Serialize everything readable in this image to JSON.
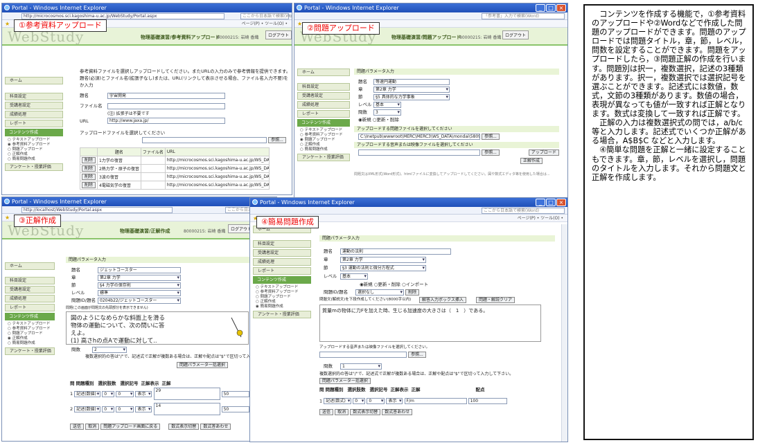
{
  "w1": {
    "title": "Portal - Windows Internet Explorer",
    "addr": "http://microcosmos.sci.kagoshima-u.ac.jp/WebStudy/Portal.aspx",
    "search": "ここから日本語で検索(Word)",
    "cmd": "ページ(P) • ツール(O) •",
    "logo": "WebStudy",
    "page_title": "物理基礎演習/参考資料アップロード",
    "user": "80000215: 岩崎 香織",
    "logout": "ログアウト",
    "label": "①参考資料アップロード",
    "intro": "参考資料ファイルを選択しアップロードしてください。またURLの入力のみで参考情報を提供できます。",
    "intro2": "題名(必須)とファイル名(拡張子なし)または、URL(リンクして表示させる場合、ファイル名入力不要)を入力し",
    "intro3": "か入力",
    "lbl_title": "題名",
    "val_title": "宇宙開発",
    "lbl_file": "ファイル名",
    "note_file": "(注) 拡張子は不要です",
    "lbl_url": "URL",
    "val_url": "http://www.jaxa.jp/",
    "select_file": "アップロードファイルを選択してください",
    "browse": "参照...",
    "col1": "題名",
    "col2": "ファイル名",
    "col3": "URL",
    "del": "削除",
    "rows": [
      {
        "t": "1力学の復習",
        "u": "http://microcosmos.sci.kagoshima-u.ac.jp/WS_DATA/basicphysics/dynamics/index.html"
      },
      {
        "t": "2熱力学・原子の復習",
        "u": "http://microcosmos.sci.kagoshima-u.ac.jp/WS_DATA/basicphysics/thermodynamics/index.html"
      },
      {
        "t": "3波の復習",
        "u": "http://microcosmos.sci.kagoshima-u.ac.jp/WS_DATA/basicphysics/wave/index.html"
      },
      {
        "t": "4電磁気学の復習",
        "u": "http://microcosmos.sci.kagoshima-u.ac.jp/WS_DATA/basicphysics/electromagnetism/index.html"
      }
    ]
  },
  "side": {
    "home": "ホーム",
    "items": [
      "科目設定",
      "受講者設定",
      "成績処理",
      "レポート"
    ],
    "section": "コンテンツ作成",
    "subs": [
      "テキストアップロード",
      "参考資料アップロード",
      "問題アップロード",
      "正解作成",
      "簡易問題作成"
    ],
    "survey": "アンケート・授業評価"
  },
  "w2": {
    "title": "Portal - Windows Internet Explorer",
    "search": "「参考書」入力で検索(Word)",
    "page_title": "物理基礎演習/問題アップロード",
    "user": "80000215: 岩崎 香織",
    "logout": "ログアウト",
    "label": "②問題アップロード",
    "param": "問題パラメータ入力",
    "lbl_name": "題名",
    "val_name": "等速円運動",
    "lbl_ch": "章",
    "val_ch": "第2章 力学",
    "lbl_sec": "節",
    "val_sec": "§5 具体的な力学事象",
    "lbl_lv": "レベル",
    "val_lv": "基本",
    "lbl_n": "問数",
    "val_n": "3",
    "mode": "◉新規 ○更新・削除",
    "word_sel": "アップロードする問題ファイルを選択してください",
    "word_path": "C:\\Inetpub\\wwwroot\\MERC\\MERC3\\WS_DATA\\mondai\\580911661101",
    "browse": "参照...",
    "media_sel": "アップロードする音声または映像ファイルを選択してください",
    "upload": "アップロード",
    "reg": "正解作成",
    "note": "問題文はXML形式(Word形式)、htmlファイルに変換してアップロードしてください。図や数式エディタ等を使用した場合は..."
  },
  "w3": {
    "title": "Portal - Windows Internet Explorer",
    "addr": "http://localhost/WebStudy/Portal.aspx",
    "search": "ここから日本語で検索(Word)",
    "page_title": "物理基礎演習/正解作成",
    "user": "80000215: 岩崎 香織",
    "logout": "ログアウト",
    "label": "③正解作成",
    "param": "問題パラメータ入力",
    "lbl_name": "題名",
    "val_name": "ジェットコースター",
    "lbl_ch": "章",
    "val_ch": "第2章 力学",
    "lbl_sec": "節",
    "val_sec": "§4 力学の保存則",
    "lbl_lv": "レベル",
    "val_lv": "標準",
    "lbl_id": "問題ID/題名",
    "val_id": "0204b22/ジェットコースター",
    "preview_hdr": "問題(この画面が問題文の先頭部分を表示できません)",
    "q1": "図のようになめらかな斜面上を滑る",
    "q2": "物体の運動について、次の問いに答",
    "q3": "えよ。",
    "q4": "(1) 高さhの点Aで運動に対して..",
    "lbl_count": "問数",
    "val_count": "2",
    "hint": "複数選択的の答は\"/\"で、記述式で正解が複数ある場合は、正解や配点は\"$\"で区切って入",
    "reset": "問題パラメータ一括選択",
    "cols": [
      "問",
      "問題種別",
      "選択肢数",
      "選択記号",
      "正解表示",
      "正解",
      "配点"
    ],
    "r1": {
      "n": "1",
      "type": "記述(数値)",
      "c": "0",
      "s": "0",
      "disp": "表示",
      "ans": "29",
      "pt": "50"
    },
    "r2": {
      "n": "2",
      "type": "記述(数値)",
      "c": "0",
      "s": "0",
      "disp": "表示",
      "ans": "14",
      "pt": "50"
    },
    "b_send": "送信",
    "b_cancel": "取消",
    "b_back": "問題アップロード画面に戻る",
    "b_fmt": "数式表示切替",
    "b_fmt2": "数式答あわせ"
  },
  "w4": {
    "title": "Portal - Windows Internet Explorer",
    "search": "ここから日本語で検索(Word)",
    "label": "④簡易問題作成",
    "param": "問題パラメータ入力",
    "lbl_name": "題名",
    "val_name": "運動の法則",
    "lbl_ch": "章",
    "val_ch": "第2章 力学",
    "lbl_sec": "節",
    "val_sec": "§3 運動の法則と微分方程式",
    "lbl_lv": "レベル",
    "val_lv": "基本",
    "mode": "◉新規 ○更新・削除 ○インポート",
    "lbl_id": "問題ID/題名",
    "val_id": "選択なし",
    "del": "削除",
    "text_hdr": "問題文(解説文)を下段作成してください(8000字以内)",
    "b_insert": "解答入力ボックス挿入",
    "b_clear": "問題・解説クリア",
    "qtext": "質量mの物体に力Fを加えた時、生じる加速度の大きさは（　1　）である。",
    "media": "アップロードする音声または映像ファイルを選択してください。",
    "browse": "参照...",
    "lbl_count": "問数",
    "val_count": "1",
    "hint": "複数選択的の答は\"/\"で、記述式で正解が複数ある場合は、正解や配点は\"$\"で区切って入力して下さい。",
    "reset": "問題パラメーター括選択",
    "cols": [
      "問",
      "問題種別",
      "選択肢数",
      "選択記号",
      "正解表示",
      "正解",
      "配点"
    ],
    "r1": {
      "n": "1",
      "type": "記述(数式)",
      "c": "0",
      "s": "0",
      "disp": "表示",
      "ans": "F/m",
      "pt": "100"
    },
    "b_send": "送信",
    "b_cancel": "取消",
    "b_fmt": "数式表示切替",
    "b_fmt2": "数式答あわせ"
  },
  "desc": {
    "p1": "　コンテンツを作成する機能で，①参考資料のアップロードや②Wordなどで作成した問題のアップロードができます。問題のアップロードでは問題タイトル，章，節，レベル，問数を設定することができます。問題をアップロードしたら，③問題正解の作成を行います。問題別は択一，複数選択，記述の3種類があります。択一，複数選択では選択記号を選ぶことができます。記述式には数値，数式，文節の3種類があります。数値の場合，表現が異なっても値が一致すれば正解となります。数式は変換して一致すれば正解です。",
    "p2": "　正解の入力は複数選択式の問では，a/b/c 等と入力します。記述式でいくつか正解がある場合，A$B$C などと入力します。",
    "p3": "　④簡単な問題を正解と一緒に設定することもできます。章，節，レベルを選択し，問題のタイトルを入力します。それから問題文と正解を作成します。"
  }
}
